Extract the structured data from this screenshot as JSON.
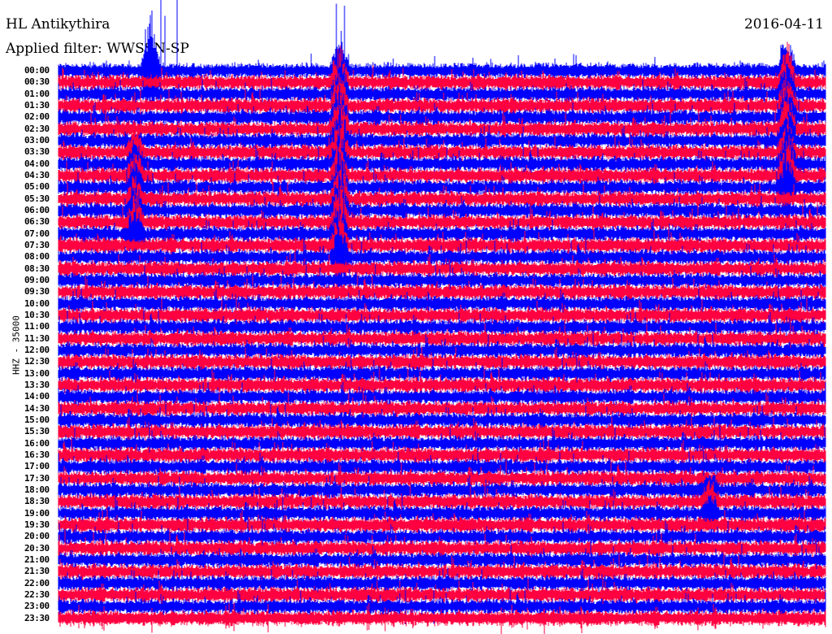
{
  "header": {
    "station": "HL Antikythira",
    "date": "2016-04-11",
    "filter": "Applied filter: WWSSN-SP"
  },
  "colors": {
    "trace_a": "#0000ff",
    "trace_b": "#ff0040"
  },
  "chart_data": {
    "type": "line",
    "title": "HL Antikythira 2016-04-11",
    "ylabel": "HHZ - 35000",
    "xlabel": "",
    "minutes_per_row": 30,
    "row_labels": [
      "00:00",
      "00:30",
      "01:00",
      "01:30",
      "02:00",
      "02:30",
      "03:00",
      "03:30",
      "04:00",
      "04:30",
      "05:00",
      "05:30",
      "06:00",
      "06:30",
      "07:00",
      "07:30",
      "08:00",
      "08:30",
      "09:00",
      "09:30",
      "10:00",
      "10:30",
      "11:00",
      "11:30",
      "12:00",
      "12:30",
      "13:00",
      "13:30",
      "14:00",
      "14:30",
      "15:00",
      "15:30",
      "16:00",
      "16:30",
      "17:00",
      "17:30",
      "18:00",
      "18:30",
      "19:00",
      "19:30",
      "20:00",
      "20:30",
      "21:00",
      "21:30",
      "22:00",
      "22:30",
      "23:00",
      "23:30"
    ],
    "events": [
      {
        "first_row": 0,
        "last_row": 0,
        "minute": 3.6,
        "strength": 5
      },
      {
        "first_row": 7,
        "last_row": 14,
        "minute": 3.0,
        "strength": 2
      },
      {
        "first_row": 0,
        "last_row": 16,
        "minute": 11.0,
        "strength": 3
      },
      {
        "first_row": 0,
        "last_row": 10,
        "minute": 28.5,
        "strength": 3
      },
      {
        "first_row": 36,
        "last_row": 38,
        "minute": 25.5,
        "strength": 1.5
      }
    ]
  }
}
